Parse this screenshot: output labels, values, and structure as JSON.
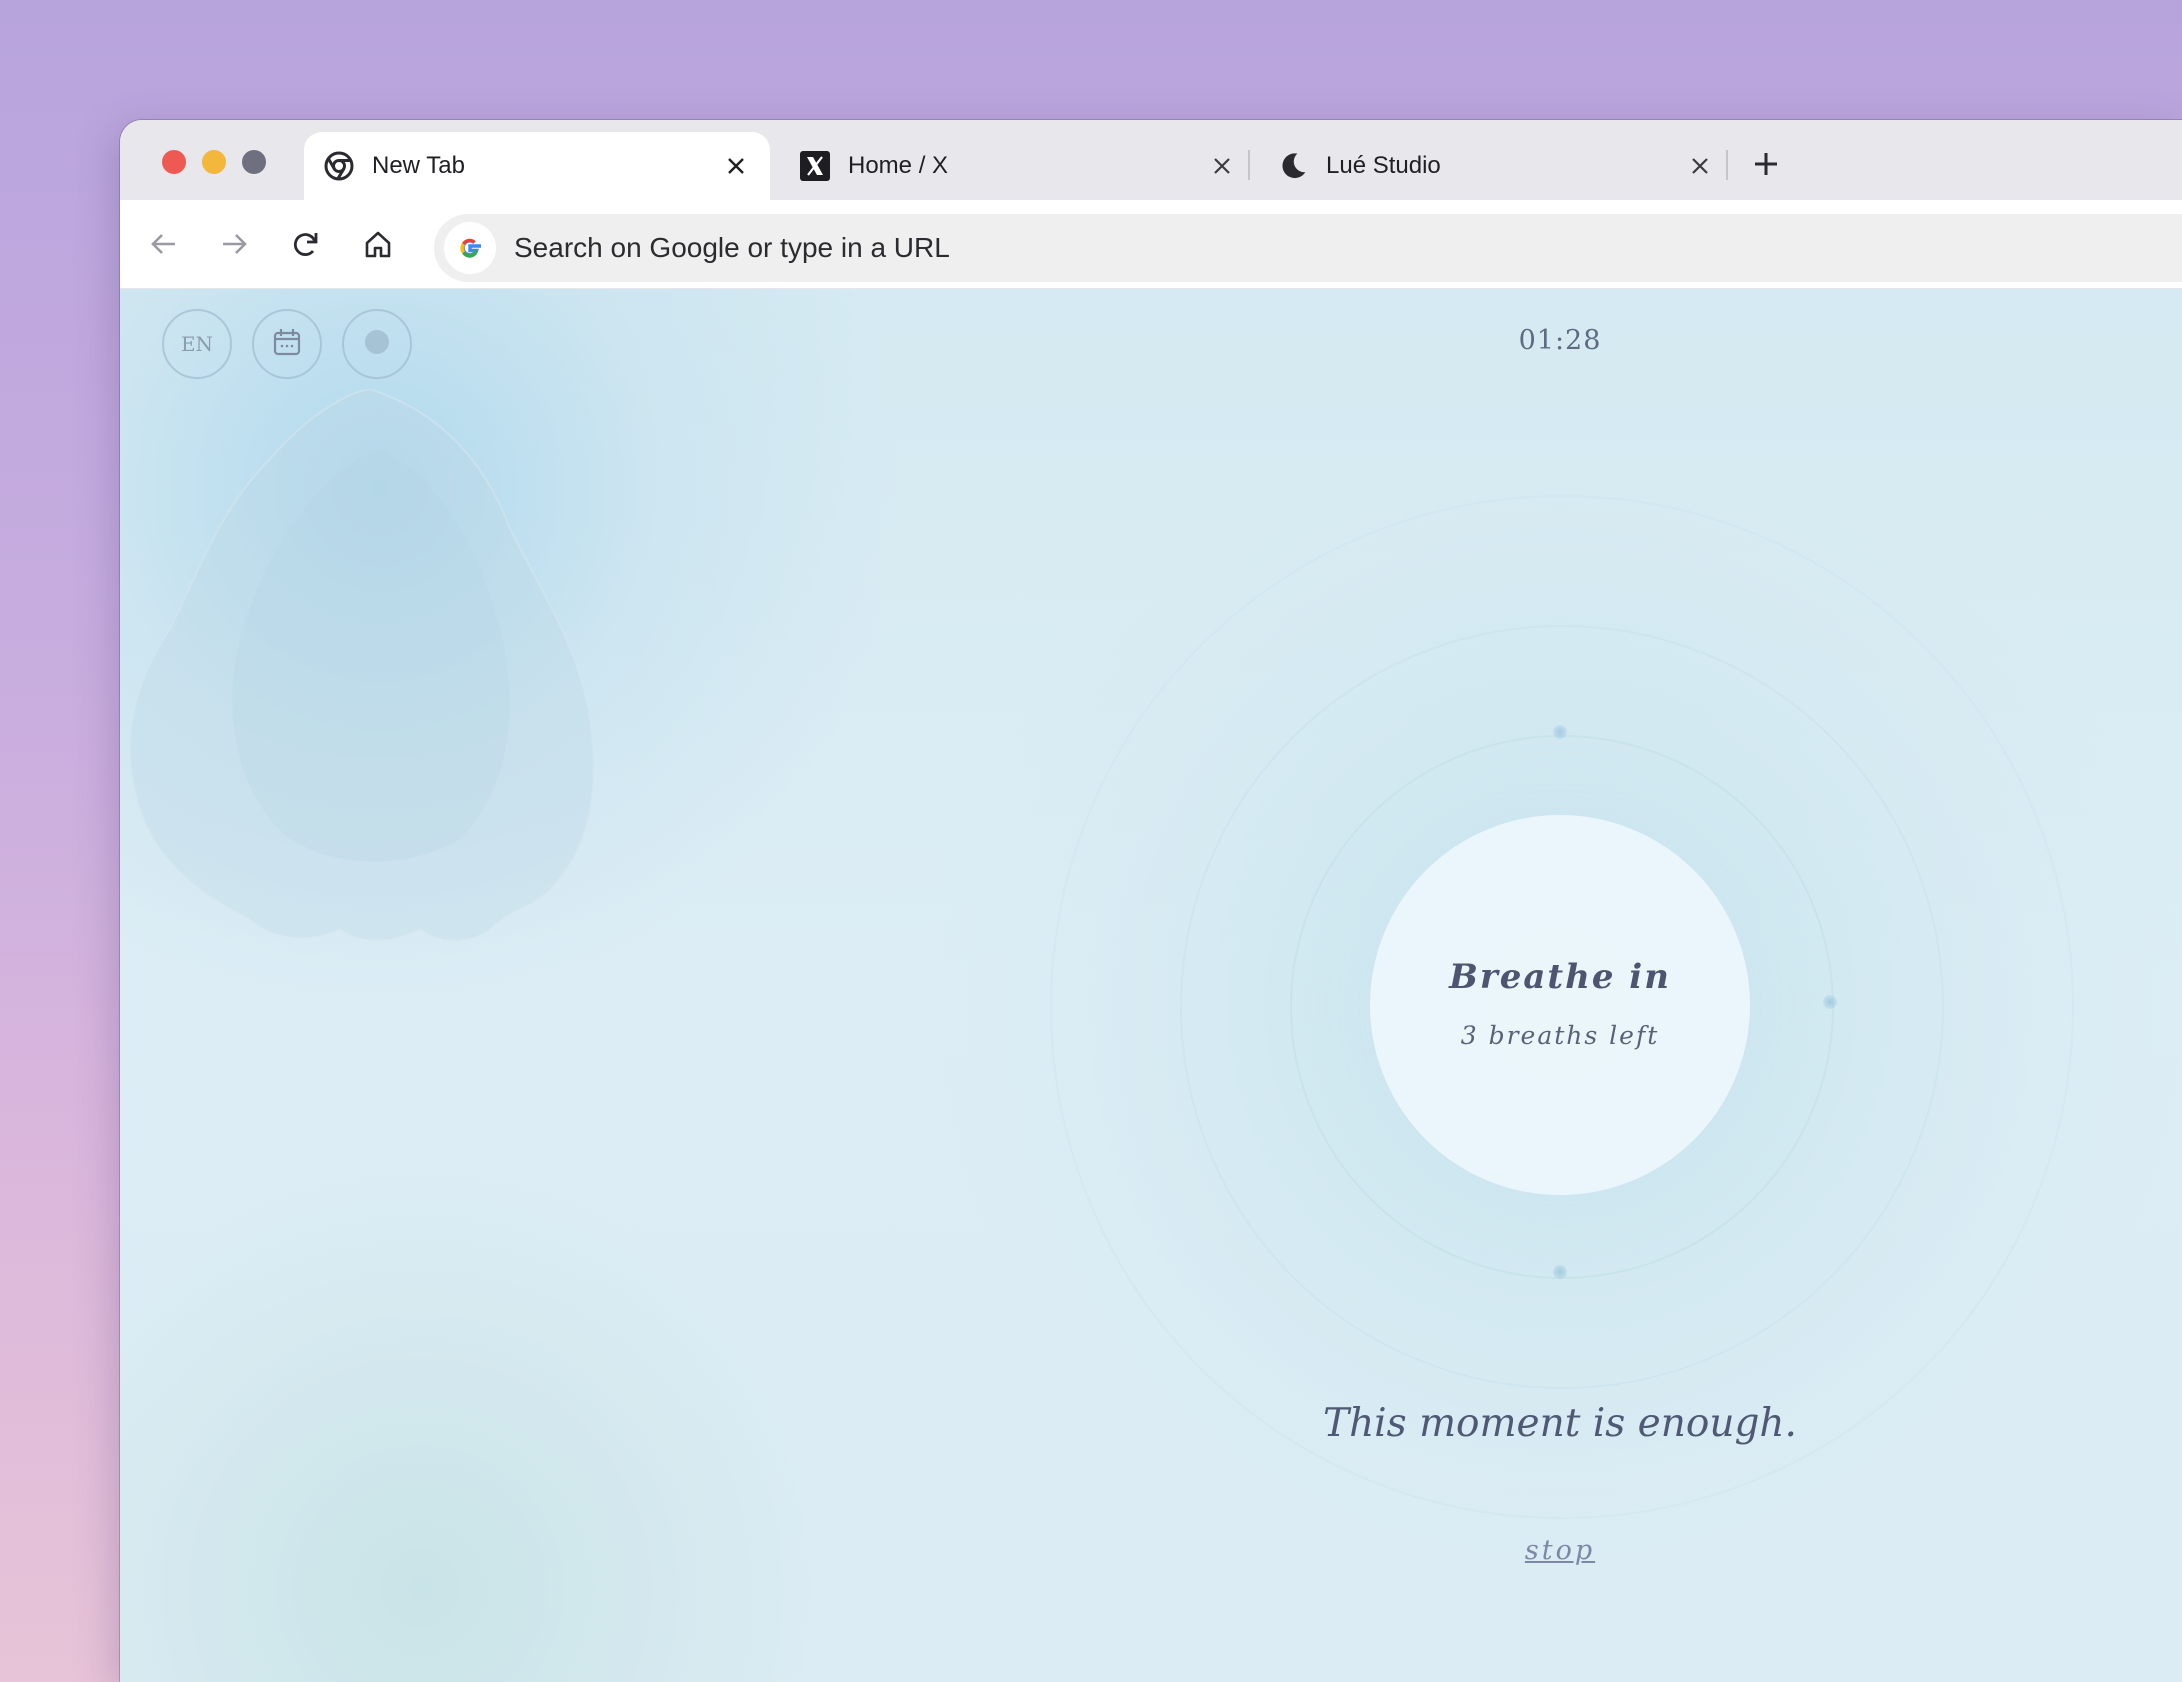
{
  "browser": {
    "tabs": [
      {
        "label": "New Tab",
        "icon": "chrome-icon",
        "active": true
      },
      {
        "label": "Home / X",
        "icon": "x-logo-icon",
        "active": false
      },
      {
        "label": "Lué Studio",
        "icon": "moon-icon",
        "active": false
      }
    ],
    "omnibox": {
      "placeholder": "Search on Google or type in a URL",
      "icon": "google-icon"
    },
    "nav_icons": [
      "back-arrow-icon",
      "forward-arrow-icon",
      "reload-icon",
      "home-icon"
    ]
  },
  "page": {
    "controls": {
      "language": "EN",
      "calendar_icon": "calendar-icon",
      "theme_icon": "circle-dot-icon"
    },
    "timer": "01:28",
    "breath": {
      "instruction": "Breathe in",
      "remaining": "3 breaths left"
    },
    "quote": "This moment is enough.",
    "stop_label": "stop"
  },
  "colors": {
    "background_top": "#b8a4dd",
    "background_bottom": "#e8c4d8",
    "page_bg": "#d8ebf3",
    "text": "#4d5570",
    "traffic_red": "#ee5a52",
    "traffic_yellow": "#f2b73b",
    "traffic_gray": "#6e7080"
  }
}
